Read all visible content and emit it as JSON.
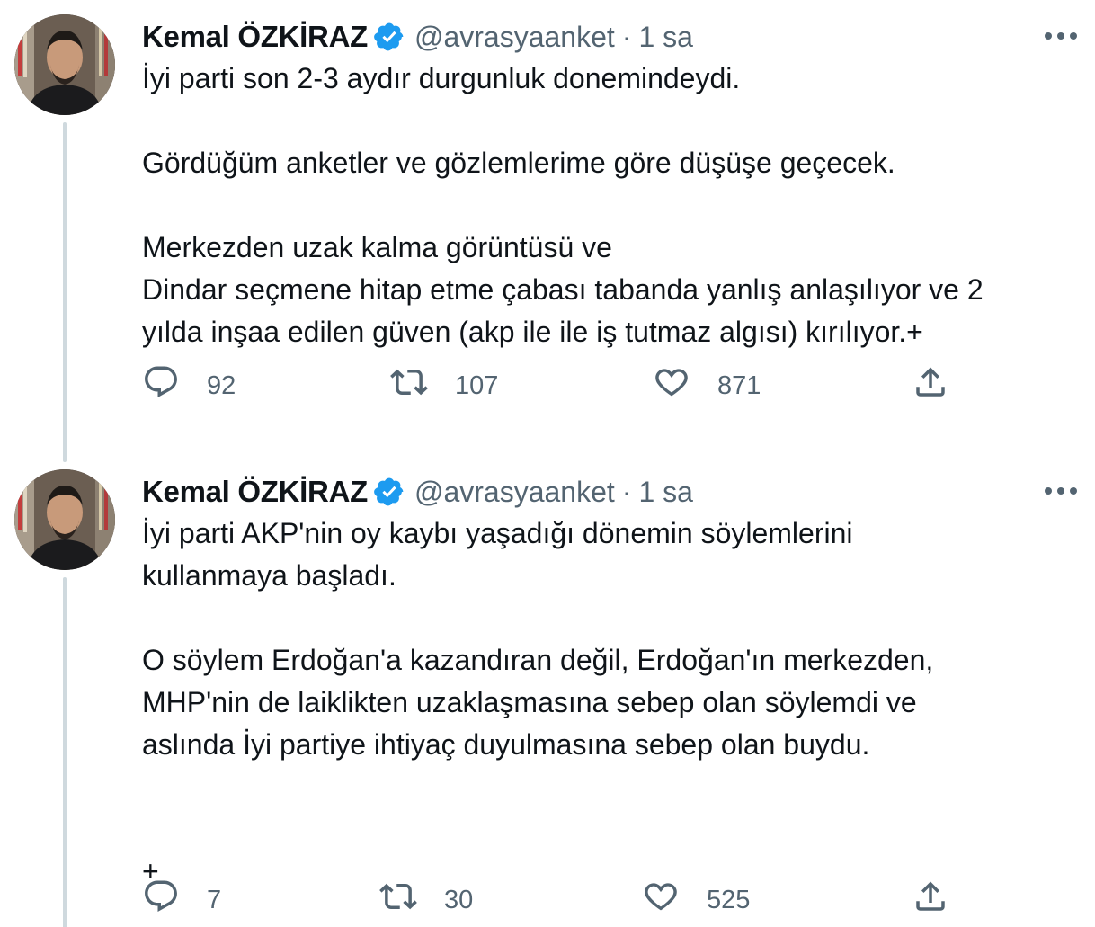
{
  "colors": {
    "verified_badge": "#1d9bf0",
    "text_primary": "#0f1419",
    "text_secondary": "#536471",
    "thread_line": "#cfd9de"
  },
  "tweets": [
    {
      "author_name": "Kemal ÖZKİRAZ",
      "handle": "@avrasyaanket",
      "separator": "·",
      "time": "1 sa",
      "paragraphs": [
        [
          "İyi parti son 2-3 aydır durgunluk donemindeydi."
        ],
        [
          "Gördüğüm anketler ve gözlemlerime göre düşüşe geçecek."
        ],
        [
          "Merkezden uzak kalma görüntüsü ve",
          "Dindar seçmene hitap etme çabası tabanda yanlış anlaşılıyor ve 2",
          "yılda inşaa edilen güven (akp ile ile iş tutmaz algısı) kırılıyor.+"
        ]
      ],
      "replies": "92",
      "retweets": "107",
      "likes": "871"
    },
    {
      "author_name": "Kemal ÖZKİRAZ",
      "handle": "@avrasyaanket",
      "separator": "·",
      "time": "1 sa",
      "paragraphs": [
        [
          "İyi parti AKP'nin oy kaybı yaşadığı dönemin söylemlerini",
          "kullanmaya başladı."
        ],
        [
          "O söylem Erdoğan'a kazandıran değil, Erdoğan'ın merkezden,",
          "MHP'nin de laiklikten uzaklaşmasına sebep olan söylemdi ve",
          "aslında İyi partiye ihtiyaç duyulmasına sebep olan buydu."
        ],
        [
          ""
        ],
        [
          "+"
        ]
      ],
      "replies": "7",
      "retweets": "30",
      "likes": "525"
    }
  ],
  "icons": {
    "verified": "verified-badge-icon",
    "more": "more-horizontal-icon",
    "reply": "reply-bubble-icon",
    "retweet": "retweet-arrows-icon",
    "like": "heart-icon",
    "share": "share-upload-icon"
  }
}
